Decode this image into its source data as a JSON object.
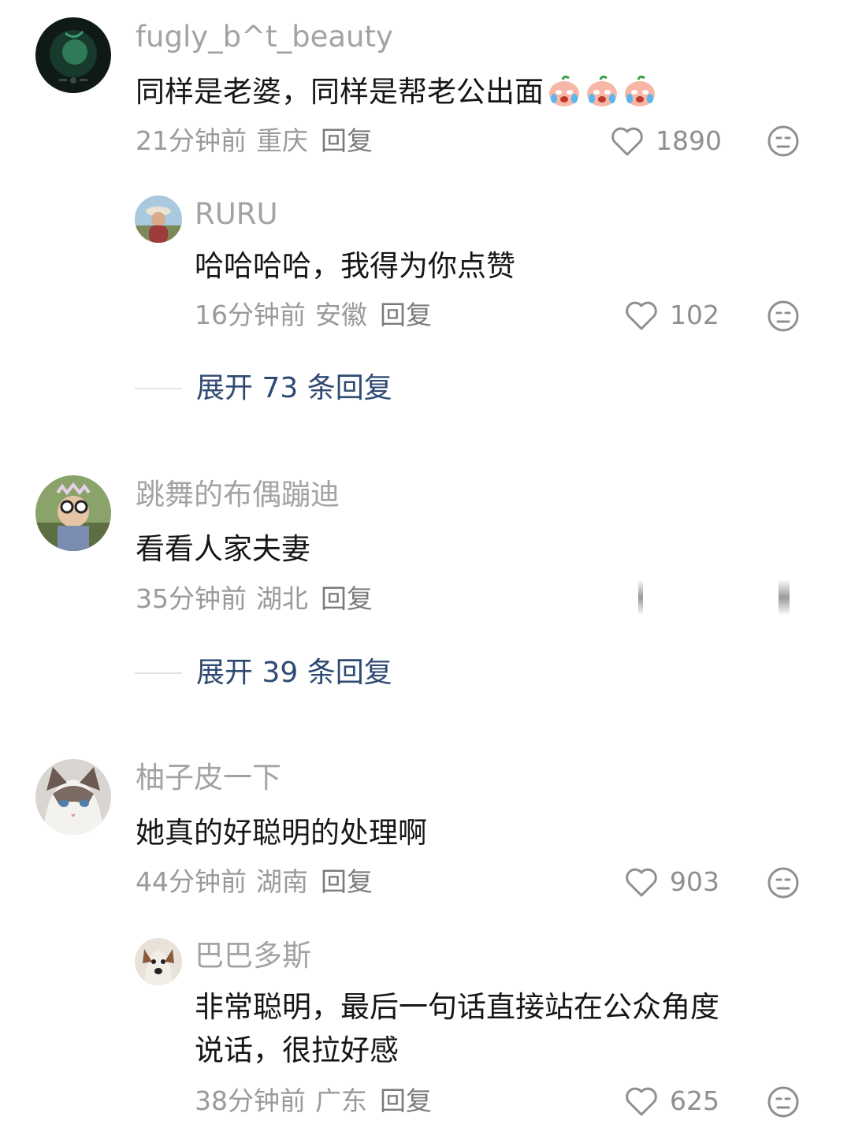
{
  "comments": [
    {
      "username": "fugly_b^t_beauty",
      "text": "同样是老婆，同样是帮老公出面",
      "emoji": [
        "crying-peach-emoji",
        "crying-peach-emoji",
        "crying-peach-emoji"
      ],
      "time": "21分钟前",
      "location": "重庆",
      "reply_label": "回复",
      "likes": "1890",
      "reply": {
        "username": "RURU",
        "text": "哈哈哈哈，我得为你点赞",
        "time": "16分钟前",
        "location": "安徽",
        "reply_label": "回复",
        "likes": "102"
      },
      "expand_label": "展开 73 条回复"
    },
    {
      "username": "跳舞的布偶蹦迪",
      "text": "看看人家夫妻",
      "time": "35分钟前",
      "location": "湖北",
      "reply_label": "回复",
      "expand_label": "展开 39 条回复"
    },
    {
      "username": "柚子皮一下",
      "text": "她真的好聪明的处理啊",
      "time": "44分钟前",
      "location": "湖南",
      "reply_label": "回复",
      "likes": "903",
      "reply": {
        "username": "巴巴多斯",
        "text_line1": "非常聪明，最后一句话直接站在公众角度",
        "text_line2": "说话，很拉好感",
        "time": "38分钟前",
        "location": "广东",
        "reply_label": "回复",
        "likes": "625"
      }
    }
  ],
  "colors": {
    "username": "#a3a3a3",
    "text": "#161616",
    "meta": "#9a9a9a",
    "expand": "#2e4a73"
  },
  "icons": {
    "like": "heart-outline-icon",
    "dislike": "meh-face-icon"
  }
}
